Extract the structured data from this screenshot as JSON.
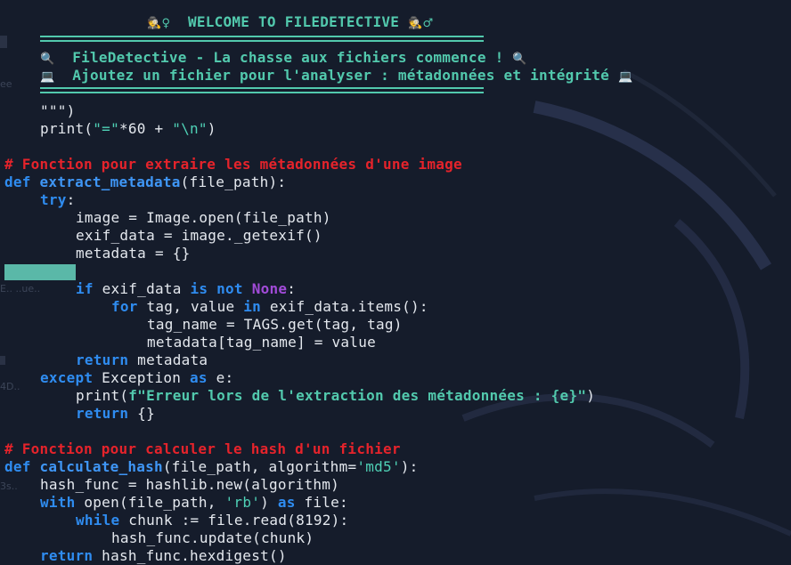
{
  "colors": {
    "background": "#151c2b",
    "keyword": "#2f8cf0",
    "string": "#4fd1b6",
    "comment": "#e5232b",
    "constant": "#a14bd8",
    "banner": "#52c9ad",
    "selection_highlight": "#5ab8a8"
  },
  "icons": {
    "detective_icon": "🕵",
    "magnifier_icon": "🔍",
    "laptop_icon": "💻",
    "female_sign": "♀",
    "male_sign": "♂"
  },
  "banner": {
    "title": "WELCOME TO FILEDETECTIVE",
    "line1": "FileDetective - La chasse aux fichiers commence !",
    "line2": "Ajoutez un fichier pour l'analyser : métadonnées et intégrité"
  },
  "code": {
    "docstring_end": "\"\"\")",
    "print_sep": {
      "call": "print(",
      "str1": "\"=\"",
      "mid": "*60 + ",
      "str2": "\"\\n\"",
      "close": ")"
    },
    "comment_metadata": "# Fonction pour extraire les métadonnées d'une image",
    "def_extract": {
      "kw": "def",
      "name": "extract_metadata",
      "params": "(file_path):"
    },
    "try_kw": "try",
    "colon": ":",
    "line_image_open": "image = Image.open(file_path)",
    "line_exif": "exif_data = image._getexif()",
    "line_metadata_init": "metadata = {}",
    "if_line": {
      "kw_if": "if",
      "var": " exif_data ",
      "kw_is": "is",
      "kw_not": "not",
      "const": "None",
      "end": ":"
    },
    "for_line": {
      "kw_for": "for",
      "vars": " tag, value ",
      "kw_in": "in",
      "rest": " exif_data.items():"
    },
    "line_tag_name": "tag_name = TAGS.get(tag, tag)",
    "line_metadata_assign": "metadata[tag_name] = value",
    "return_metadata": {
      "kw": "return",
      "rest": " metadata"
    },
    "except_line": {
      "kw_except": "except",
      "cls": " Exception ",
      "kw_as": "as",
      "rest": " e:"
    },
    "print_error": {
      "call": "print(",
      "fstring": "f\"Erreur lors de l'extraction des métadonnées : {e}\"",
      "close": ")"
    },
    "return_empty": {
      "kw": "return",
      "rest": " {}"
    },
    "comment_hash": "# Fonction pour calculer le hash d'un fichier",
    "def_hash": {
      "kw": "def",
      "name": "calculate_hash",
      "params": "(file_path, algorithm=",
      "default": "'md5'",
      "end": "):"
    },
    "line_hash_func": "hash_func = hashlib.new(algorithm)",
    "with_line": {
      "kw_with": "with",
      "call": " open(file_path, ",
      "mode": "'rb'",
      "close": ") ",
      "kw_as": "as",
      "rest": " file:"
    },
    "while_line": {
      "kw_while": "while",
      "rest": " chunk := file.read(8192):"
    },
    "line_update": "hash_func.update(chunk)",
    "return_hex": {
      "kw": "return",
      "rest": " hash_func.hexdigest()"
    }
  }
}
